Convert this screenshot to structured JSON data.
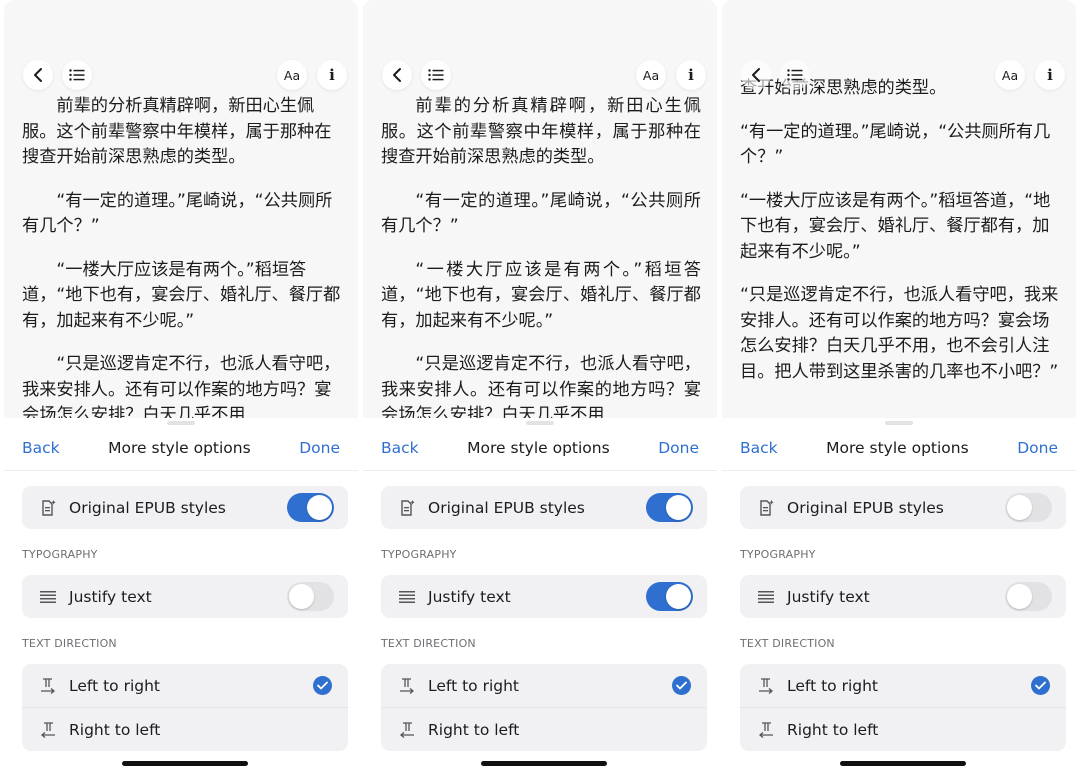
{
  "screens": [
    {
      "reader": {
        "paragraphs": [
          "前辈的分析真精辟啊，新田心生佩服。这个前辈警察中年模样，属于那种在搜查开始前深思熟虑的类型。",
          "“有一定的道理。”尾崎说，“公共厕所有几个？”",
          "“一楼大厅应该是有两个。”稻垣答道，“地下也有，宴会厅、婚礼厅、餐厅都有，加起来有不少呢。”",
          "“只是巡逻肯定不行，也派人看守吧，我来安排人。还有可以作案的地方吗？宴会场怎么安排？白天几乎不用"
        ],
        "font_button": "Aa",
        "info_button": "i"
      },
      "sheet": {
        "back": "Back",
        "title": "More style options",
        "done": "Done",
        "original_epub": {
          "label": "Original EPUB styles",
          "on": true
        },
        "typography_label": "TYPOGRAPHY",
        "justify": {
          "label": "Justify text",
          "on": false
        },
        "direction_label": "TEXT DIRECTION",
        "ltr": {
          "label": "Left to right",
          "selected": true
        },
        "rtl": {
          "label": "Right to left",
          "selected": false
        }
      }
    },
    {
      "reader": {
        "paragraphs": [
          "前辈的分析真精辟啊，新田心生佩服。这个前辈警察中年模样，属于那种在搜查开始前深思熟虑的类型。",
          "“有一定的道理。”尾崎说，“公共厕所有几个？”",
          "“一楼大厅应该是有两个。”稻垣答道，“地下也有，宴会厅、婚礼厅、餐厅都有，加起来有不少呢。”",
          "“只是巡逻肯定不行，也派人看守吧，我来安排人。还有可以作案的地方吗？宴会场怎么安排？白天几乎不用"
        ],
        "font_button": "Aa",
        "info_button": "i"
      },
      "sheet": {
        "back": "Back",
        "title": "More style options",
        "done": "Done",
        "original_epub": {
          "label": "Original EPUB styles",
          "on": true
        },
        "typography_label": "TYPOGRAPHY",
        "justify": {
          "label": "Justify text",
          "on": true
        },
        "direction_label": "TEXT DIRECTION",
        "ltr": {
          "label": "Left to right",
          "selected": true
        },
        "rtl": {
          "label": "Right to left",
          "selected": false
        }
      }
    },
    {
      "reader": {
        "paragraphs": [
          "查开始前深思熟虑的类型。",
          "“有一定的道理。”尾崎说，“公共厕所有几个？”",
          "“一楼大厅应该是有两个。”稻垣答道，“地下也有，宴会厅、婚礼厅、餐厅都有，加起来有不少呢。”",
          "“只是巡逻肯定不行，也派人看守吧，我来安排人。还有可以作案的地方吗？宴会场怎么安排？白天几乎不用，也不会引人注目。把人带到这里杀害的几率也不小吧？”"
        ],
        "font_button": "Aa",
        "info_button": "i"
      },
      "sheet": {
        "back": "Back",
        "title": "More style options",
        "done": "Done",
        "original_epub": {
          "label": "Original EPUB styles",
          "on": false
        },
        "typography_label": "TYPOGRAPHY",
        "justify": {
          "label": "Justify text",
          "on": false
        },
        "direction_label": "TEXT DIRECTION",
        "ltr": {
          "label": "Left to right",
          "selected": true
        },
        "rtl": {
          "label": "Right to left",
          "selected": false
        }
      }
    }
  ],
  "colors": {
    "accent": "#2f6fd0",
    "toggle_off": "#e2e2e5",
    "group_bg": "#f1f1f3",
    "reader_bg": "#f7f7f8"
  },
  "icons": [
    "chevron-left-icon",
    "list-icon",
    "document-sparkle-icon",
    "justify-lines-icon",
    "text-ltr-icon",
    "text-rtl-icon",
    "checkmark-icon"
  ]
}
